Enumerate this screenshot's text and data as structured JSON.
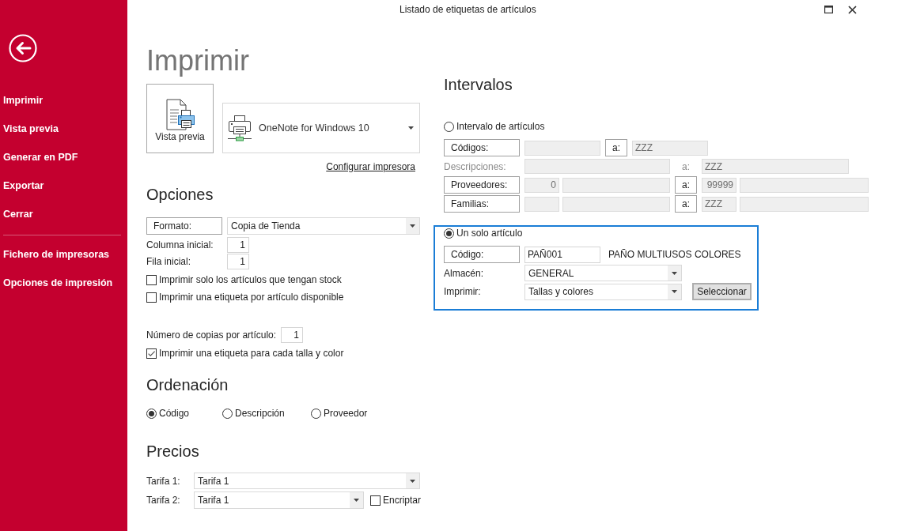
{
  "window": {
    "title": "Listado de etiquetas de artículos"
  },
  "sidebar": {
    "items": [
      {
        "label": "Imprimir"
      },
      {
        "label": "Vista previa"
      },
      {
        "label": "Generar en PDF"
      },
      {
        "label": "Exportar"
      },
      {
        "label": "Cerrar"
      }
    ],
    "tools": [
      {
        "label": "Fichero de impresoras"
      },
      {
        "label": "Opciones de impresión"
      }
    ]
  },
  "page_title": "Imprimir",
  "print": {
    "preview_button": "Vista previa",
    "printer": "OneNote for Windows 10",
    "setup_link": "Configurar impresora"
  },
  "options": {
    "title": "Opciones",
    "format": {
      "label": "Formato:",
      "value": "Copia de Tienda"
    },
    "start_column": {
      "label": "Columna inicial:",
      "value": "1"
    },
    "start_row": {
      "label": "Fila inicial:",
      "value": "1"
    },
    "checks": [
      {
        "label": "Imprimir solo los artículos que tengan stock",
        "checked": false
      },
      {
        "label": "Imprimir una etiqueta por artículo disponible",
        "checked": false
      }
    ],
    "copies": {
      "label": "Número de copias por artículo:",
      "value": "1"
    },
    "size_color_check": {
      "label": "Imprimir una etiqueta para cada talla y color",
      "checked": true
    }
  },
  "ordering": {
    "title": "Ordenación",
    "options": [
      {
        "label": "Código",
        "selected": true
      },
      {
        "label": "Descripción",
        "selected": false
      },
      {
        "label": "Proveedor",
        "selected": false
      }
    ]
  },
  "prices": {
    "title": "Precios",
    "rate_1": {
      "label": "Tarifa 1:",
      "value": "Tarifa 1"
    },
    "rate_2": {
      "label": "Tarifa 2:",
      "value": "Tarifa 1"
    },
    "encrypt": {
      "label": "Encriptar",
      "checked": false
    }
  },
  "intervals": {
    "title": "Intervalos",
    "range": {
      "label": "Intervalo de artículos",
      "selected": false,
      "rows": [
        {
          "label": "Códigos:",
          "kind": "boxed",
          "from": [
            {
              "kind": "code"
            }
          ],
          "to_label": "a:",
          "to": [
            {
              "kind": "code",
              "value": "ZZZ"
            }
          ]
        },
        {
          "label": "Descripciones:",
          "kind": "plain",
          "from": [
            {
              "kind": "wide"
            }
          ],
          "to_label": "a:",
          "to": [
            {
              "kind": "wide",
              "value": "ZZZ"
            }
          ]
        },
        {
          "label": "Proveedores:",
          "kind": "boxed",
          "from": [
            {
              "kind": "number",
              "value": "0"
            },
            {
              "kind": "wide"
            }
          ],
          "to_label": "a:",
          "to": [
            {
              "kind": "number",
              "value": "99999"
            },
            {
              "kind": "wide"
            }
          ]
        },
        {
          "label": "Familias:",
          "kind": "boxed",
          "from": [
            {
              "kind": "short"
            },
            {
              "kind": "wide"
            }
          ],
          "to_label": "a:",
          "to": [
            {
              "kind": "short",
              "value": "ZZZ"
            },
            {
              "kind": "wide"
            }
          ]
        }
      ]
    },
    "single": {
      "label": "Un solo artículo",
      "selected": true,
      "code": {
        "label": "Código:",
        "value": "PAÑ001",
        "description": "PAÑO MULTIUSOS COLORES"
      },
      "warehouse": {
        "label": "Almacén:",
        "value": "GENERAL"
      },
      "print": {
        "label": "Imprimir:",
        "value": "Tallas y colores"
      },
      "select_button": "Seleccionar"
    }
  }
}
